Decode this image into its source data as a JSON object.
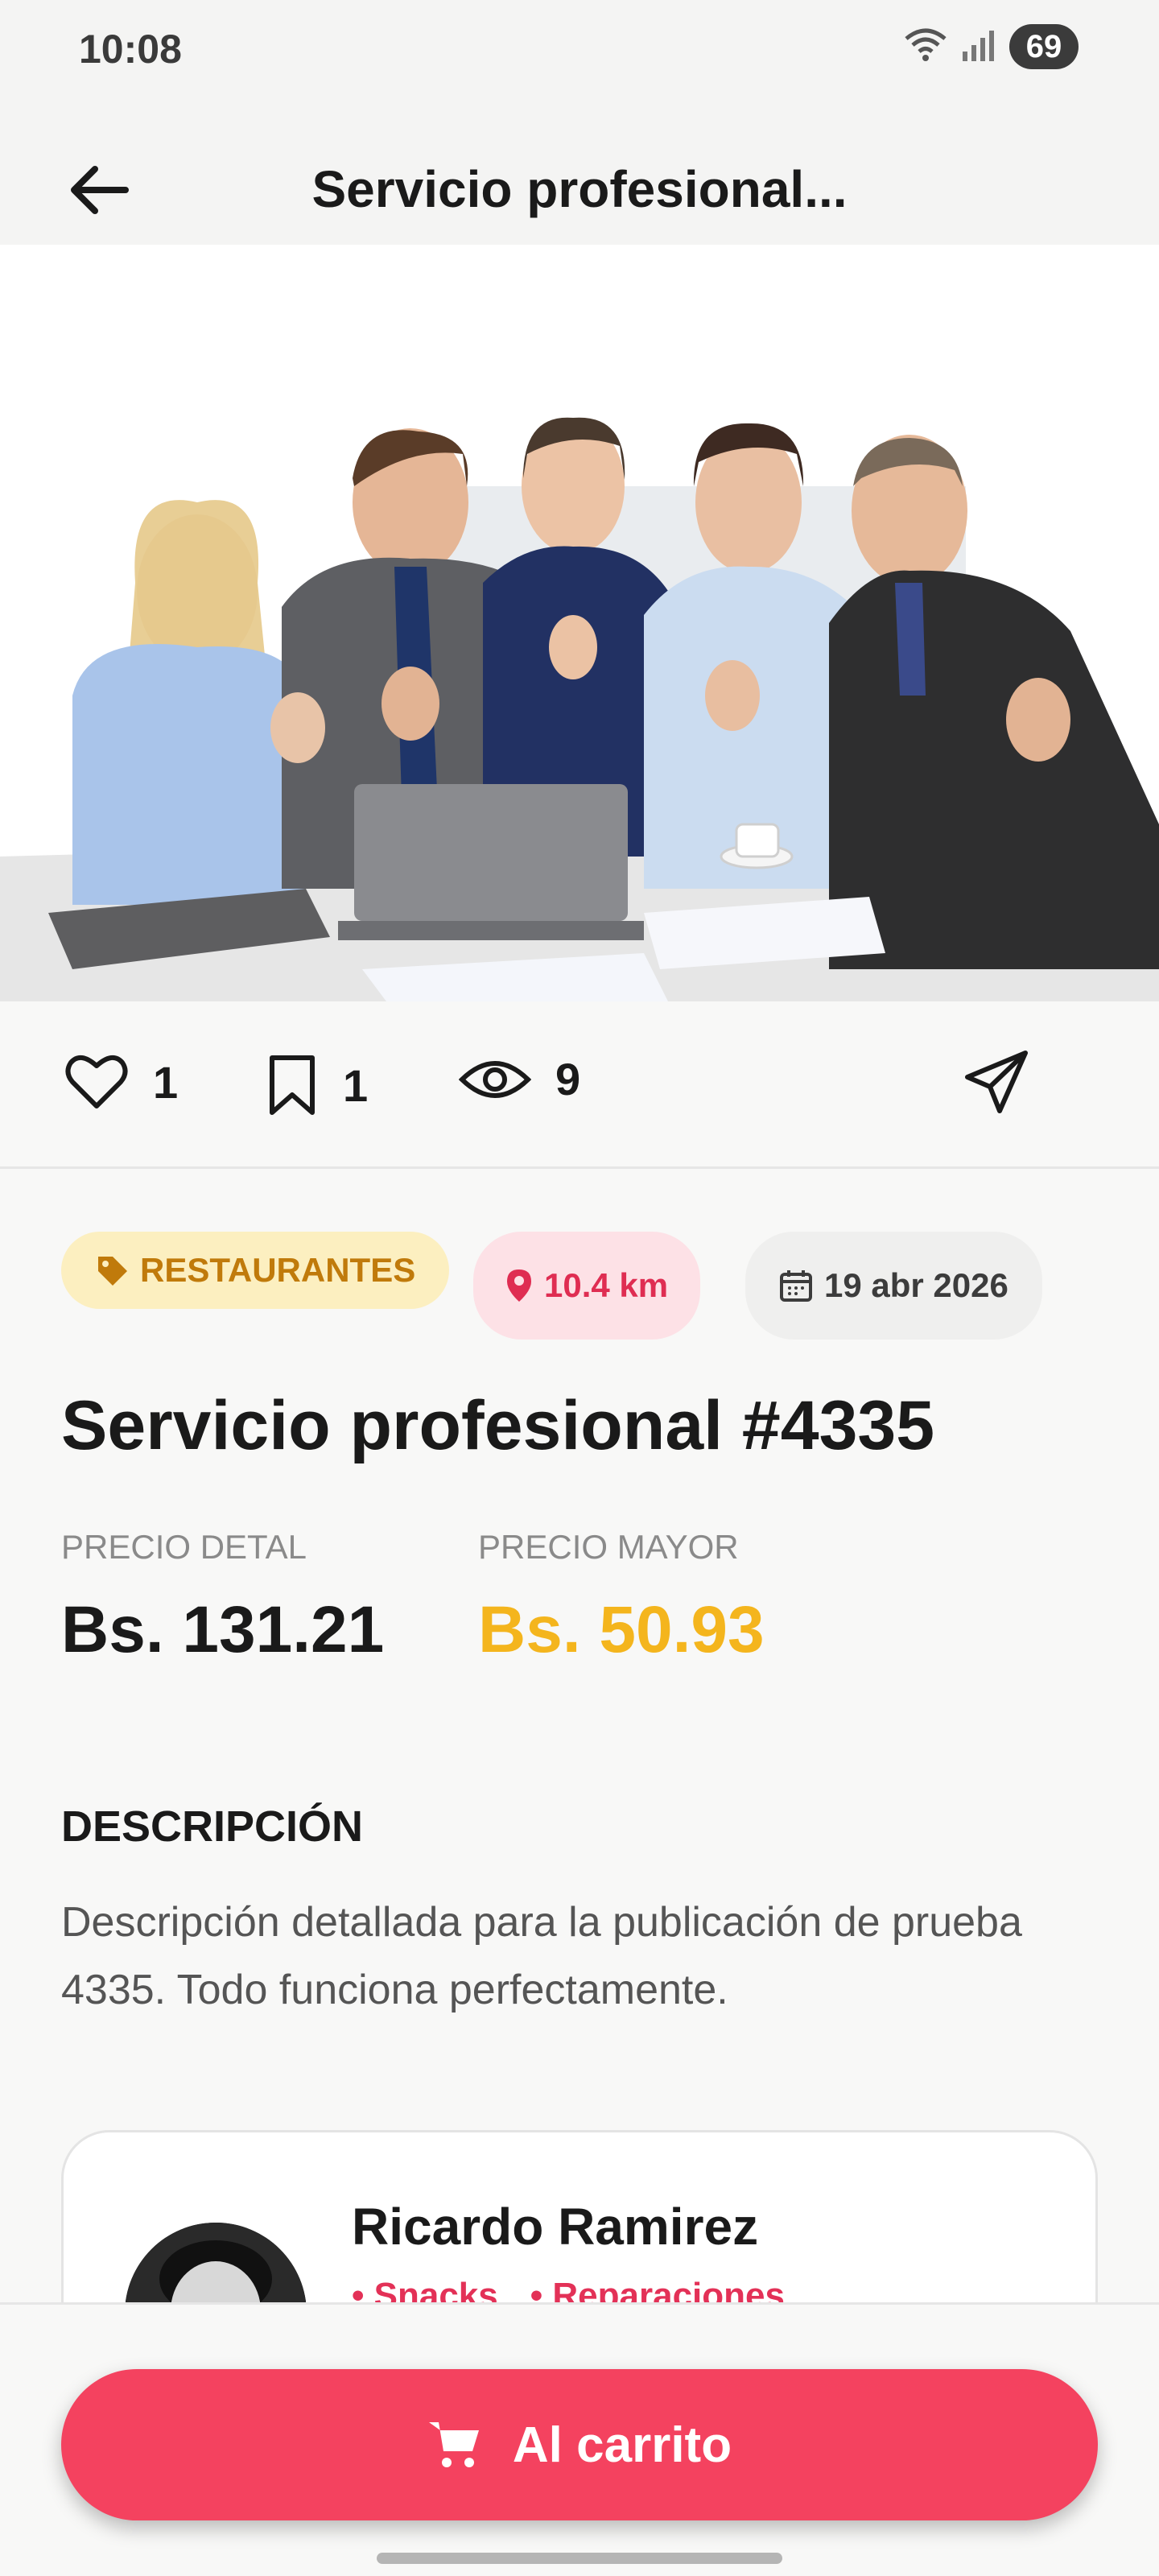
{
  "status_bar": {
    "time": "10:08",
    "battery": "69",
    "icons": [
      "wifi-icon",
      "signal-icon",
      "battery-icon"
    ]
  },
  "app_bar": {
    "title": "Servicio profesional...",
    "back_icon": "arrow-left-icon"
  },
  "hero": {
    "icon": "business-team-photo"
  },
  "stats": {
    "likes": "1",
    "saves": "1",
    "views": "9",
    "icons": [
      "heart-icon",
      "bookmark-icon",
      "eye-icon",
      "send-icon"
    ]
  },
  "chips": {
    "category": "RESTAURANTES",
    "distance": "10.4 km",
    "date": "19 abr 2026"
  },
  "listing": {
    "title": "Servicio profesional #4335"
  },
  "prices": {
    "retail_label": "PRECIO DETAL",
    "retail_value": "Bs. 131.21",
    "wholesale_label": "PRECIO MAYOR",
    "wholesale_value": "Bs. 50.93"
  },
  "description": {
    "heading": "DESCRIPCIÓN",
    "text": "Descripción detallada para la publicación de prueba 4335. Todo funciona perfectamente."
  },
  "seller": {
    "name": "Ricardo Ramirez",
    "tags": [
      "• Snacks",
      "• Reparaciones"
    ]
  },
  "cta": {
    "label": "Al carrito",
    "icon": "cart-icon"
  },
  "colors": {
    "accent": "#f4425f",
    "wholesale": "#f4b51d",
    "category_bg": "#fcefc0",
    "category_fg": "#c07a0b"
  }
}
